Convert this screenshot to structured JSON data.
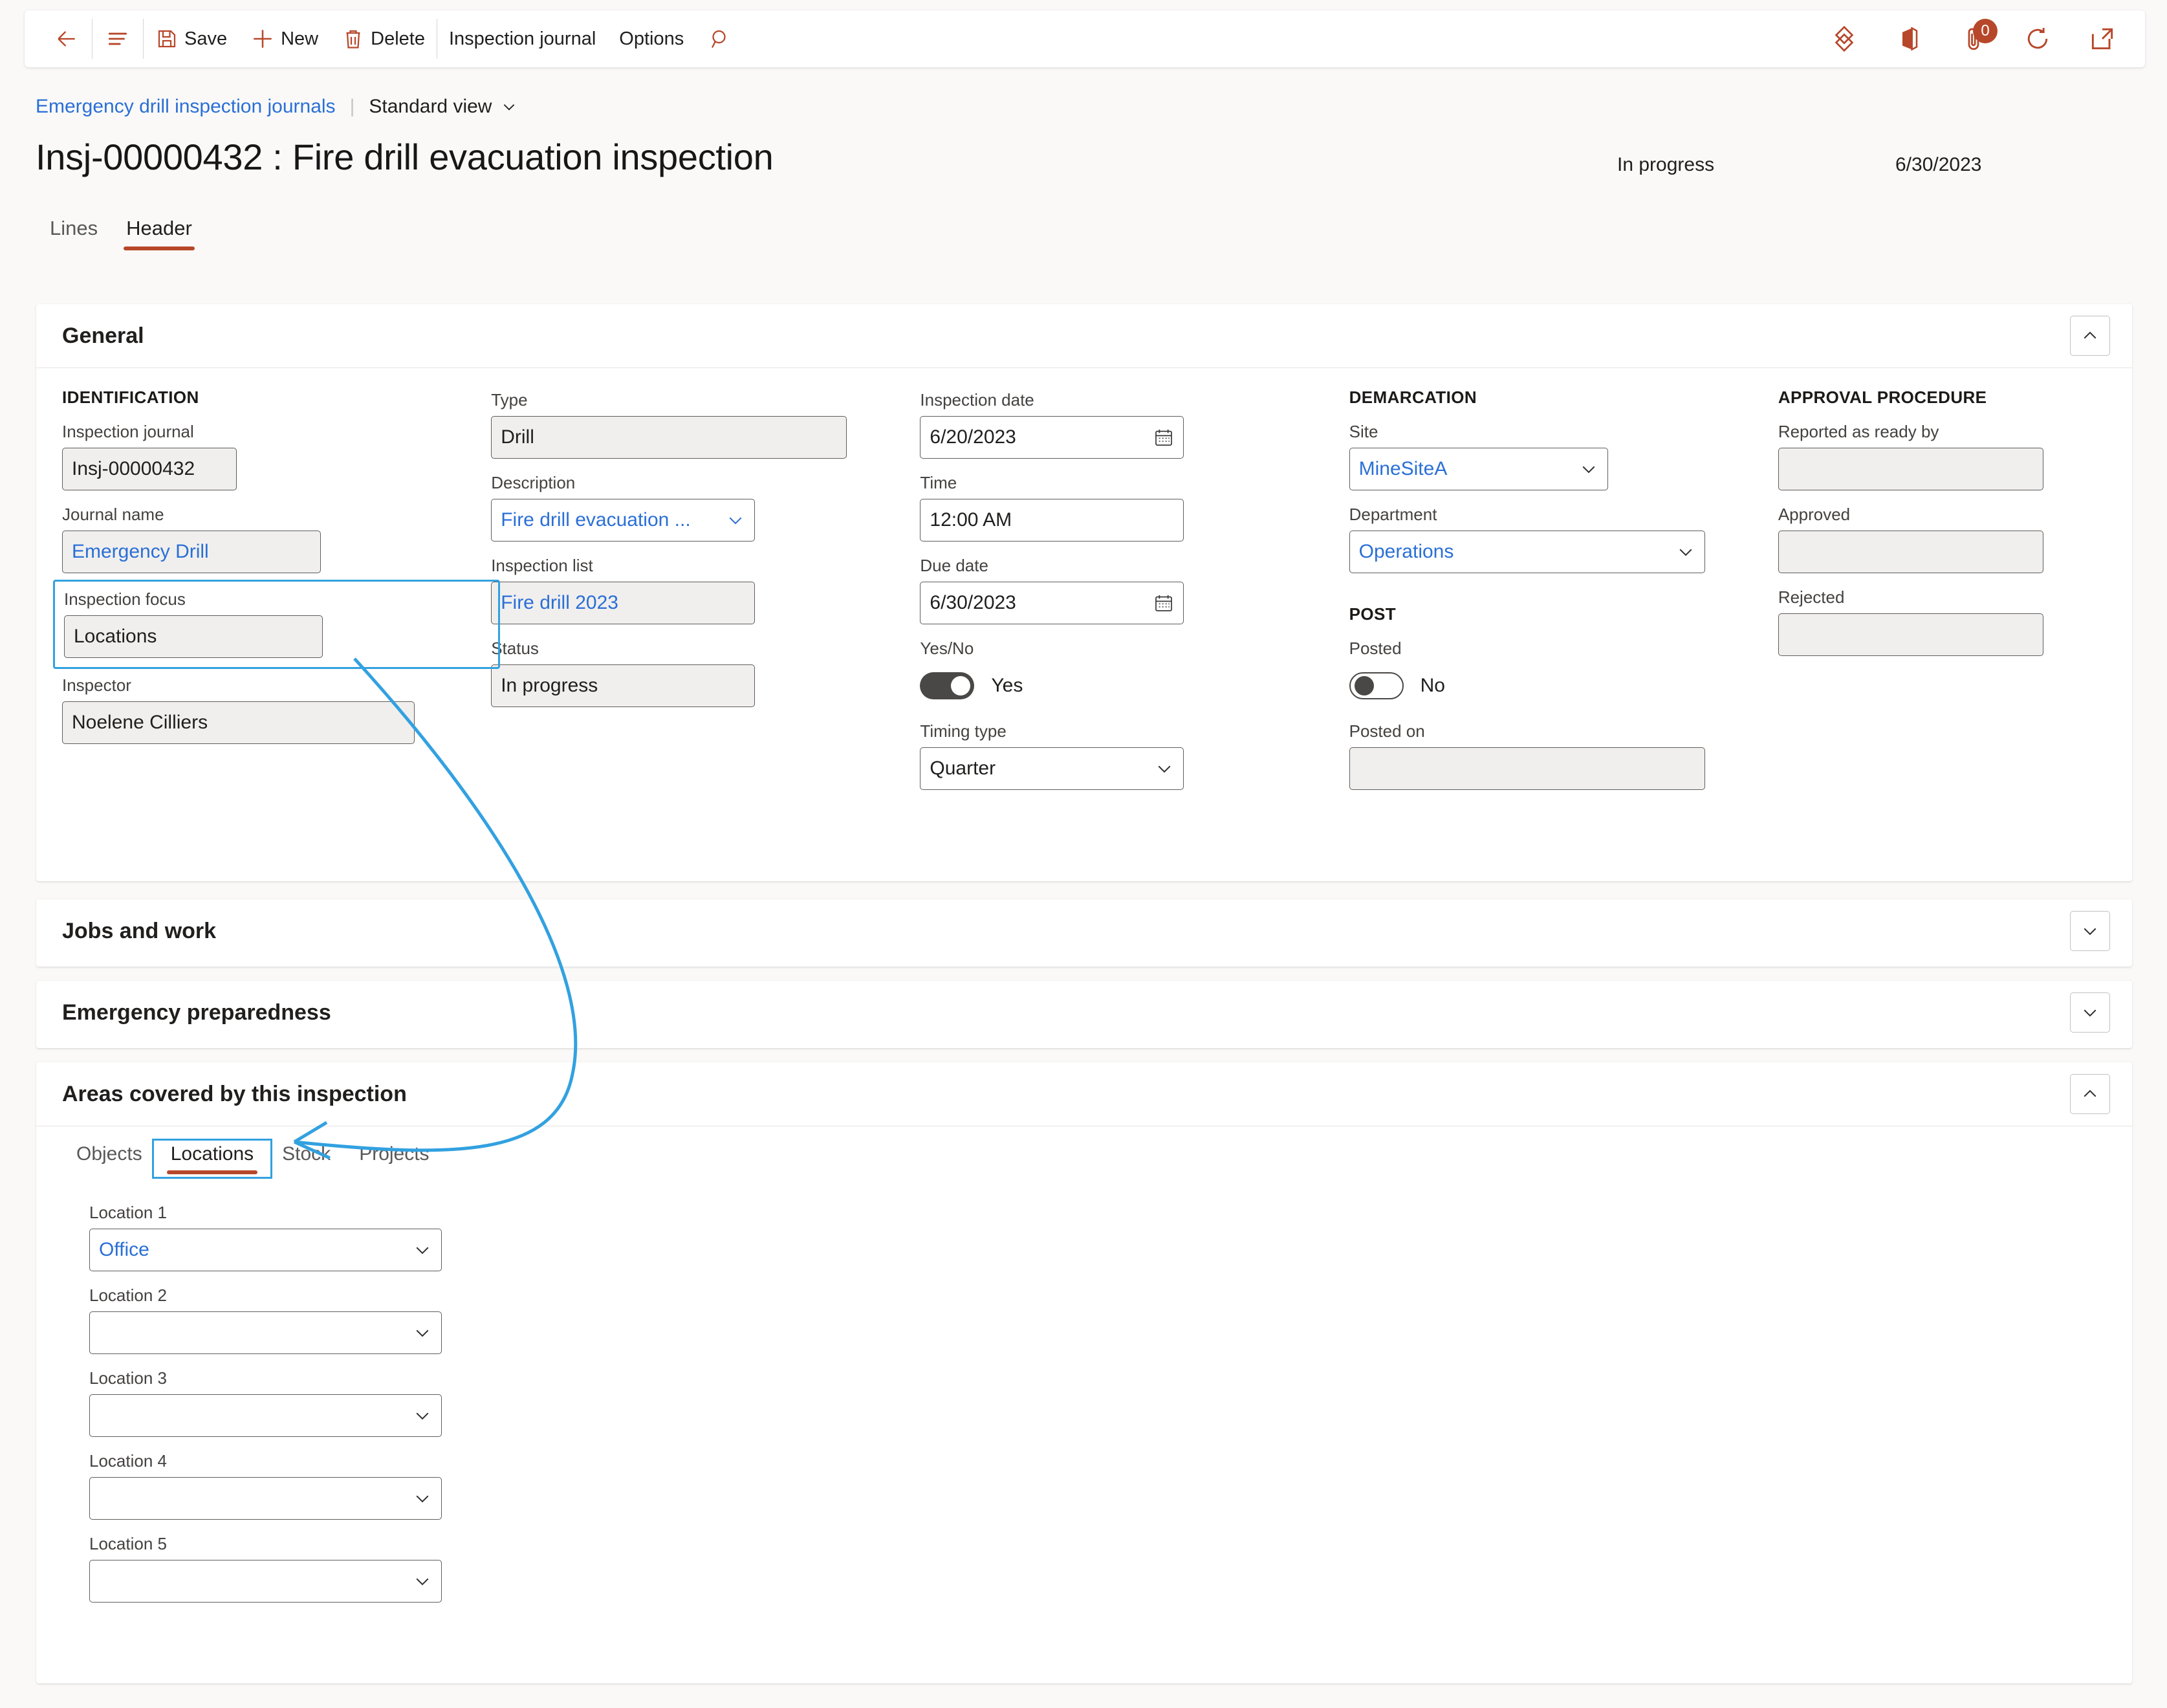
{
  "toolbar": {
    "back_label": "Back",
    "menu_label": "Show navigation",
    "save_label": "Save",
    "new_label": "New",
    "delete_label": "Delete",
    "inspection_journal_label": "Inspection journal",
    "options_label": "Options",
    "search_label": "Search",
    "attachments_badge": "0"
  },
  "breadcrumb": {
    "parent": "Emergency drill inspection journals",
    "divider": "|",
    "view": "Standard view"
  },
  "header": {
    "title": "Insj-00000432 : Fire drill evacuation inspection",
    "status": "In progress",
    "date": "6/30/2023"
  },
  "tabs": [
    {
      "label": "Lines",
      "active": false
    },
    {
      "label": "Header",
      "active": true
    }
  ],
  "sections": {
    "general": {
      "title": "General",
      "expanded": true,
      "identification": {
        "group_title": "Identification",
        "inspection_journal": {
          "label": "Inspection journal",
          "value": "Insj-00000432"
        },
        "journal_name": {
          "label": "Journal name",
          "value": "Emergency Drill"
        },
        "inspection_focus": {
          "label": "Inspection focus",
          "value": "Locations"
        },
        "inspector": {
          "label": "Inspector",
          "value": "Noelene Cilliers"
        }
      },
      "details": {
        "type": {
          "label": "Type",
          "value": "Drill"
        },
        "description": {
          "label": "Description",
          "value": "Fire drill evacuation ..."
        },
        "inspection_list": {
          "label": "Inspection list",
          "value": "Fire drill 2023"
        },
        "status": {
          "label": "Status",
          "value": "In progress"
        }
      },
      "schedule": {
        "inspection_date": {
          "label": "Inspection date",
          "value": "6/20/2023"
        },
        "time": {
          "label": "Time",
          "value": "12:00 AM"
        },
        "due_date": {
          "label": "Due date",
          "value": "6/30/2023"
        },
        "yes_no": {
          "label": "Yes/No",
          "value": "Yes",
          "on": true
        },
        "timing_type": {
          "label": "Timing type",
          "value": "Quarter"
        }
      },
      "demarcation": {
        "group_title": "Demarcation",
        "site": {
          "label": "Site",
          "value": "MineSiteA"
        },
        "department": {
          "label": "Department",
          "value": "Operations"
        }
      },
      "post": {
        "group_title": "Post",
        "posted": {
          "label": "Posted",
          "value": "No",
          "on": false
        },
        "posted_on": {
          "label": "Posted on",
          "value": ""
        }
      },
      "approval": {
        "group_title": "Approval procedure",
        "reported_as_ready_by": {
          "label": "Reported as ready by",
          "value": ""
        },
        "approved": {
          "label": "Approved",
          "value": ""
        },
        "rejected": {
          "label": "Rejected",
          "value": ""
        }
      }
    },
    "jobs_and_work": {
      "title": "Jobs and work",
      "expanded": false
    },
    "emergency_preparedness": {
      "title": "Emergency preparedness",
      "expanded": false
    },
    "areas_covered": {
      "title": "Areas covered by this inspection",
      "expanded": true,
      "tabs": [
        {
          "label": "Objects",
          "active": false
        },
        {
          "label": "Locations",
          "active": true
        },
        {
          "label": "Stock",
          "active": false
        },
        {
          "label": "Projects",
          "active": false
        }
      ],
      "locations": [
        {
          "label": "Location 1",
          "value": "Office"
        },
        {
          "label": "Location 2",
          "value": ""
        },
        {
          "label": "Location 3",
          "value": ""
        },
        {
          "label": "Location 4",
          "value": ""
        },
        {
          "label": "Location 5",
          "value": ""
        }
      ]
    }
  },
  "colors": {
    "accent": "#b7472a",
    "link": "#2a6fd6",
    "annotation": "#32a1e0",
    "page_bg": "#faf9f8"
  }
}
